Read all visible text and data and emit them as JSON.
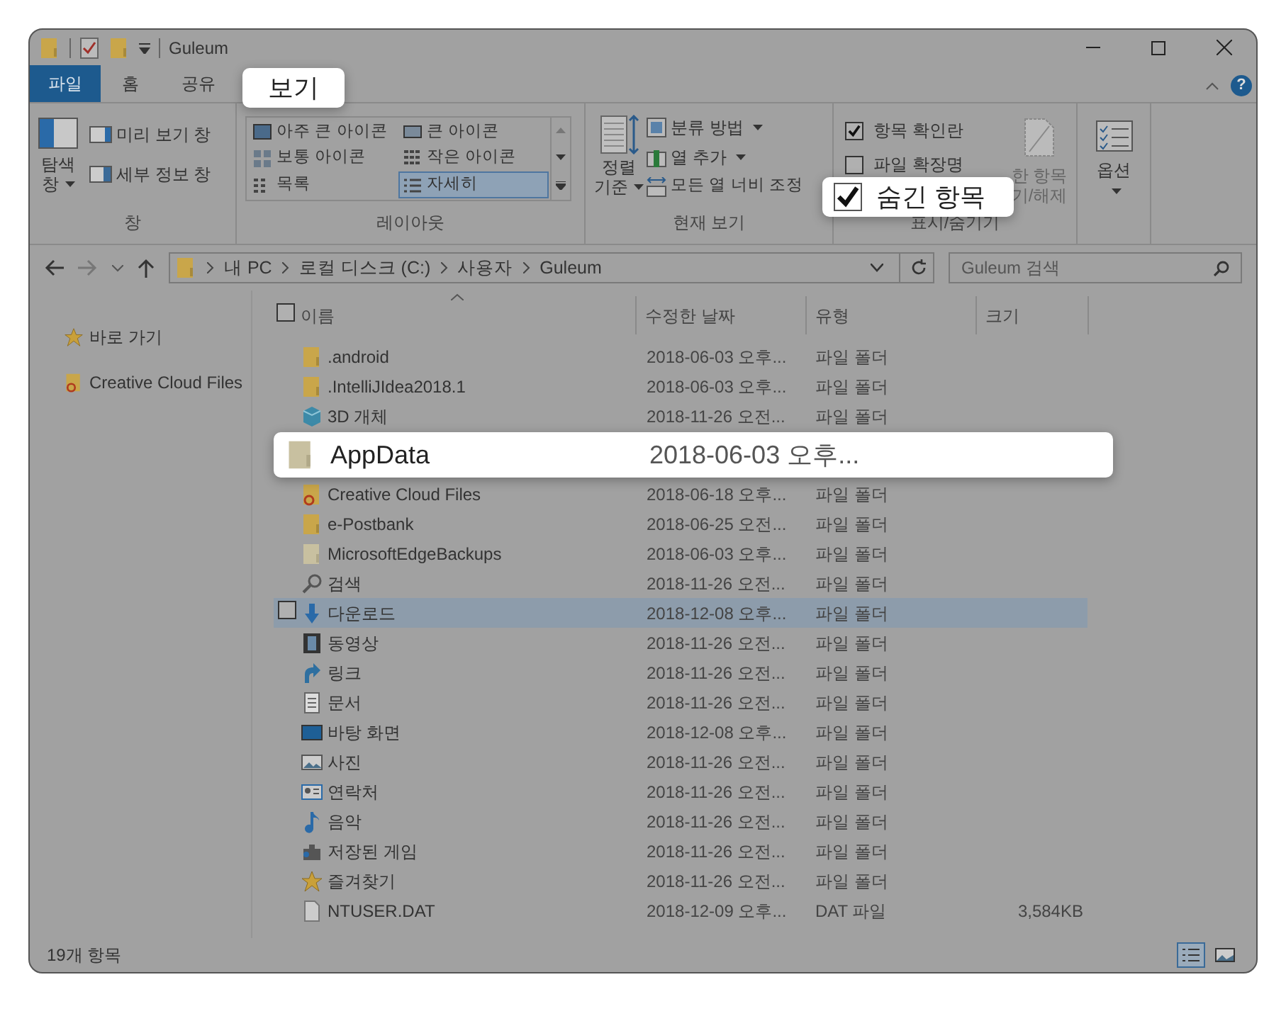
{
  "title_bar": {
    "title": "Guleum"
  },
  "ribbon_tabs": [
    {
      "label": "파일",
      "kind": "file",
      "selected": false
    },
    {
      "label": "홈",
      "kind": "tab",
      "selected": false
    },
    {
      "label": "공유",
      "kind": "tab",
      "selected": false
    },
    {
      "label": "보기",
      "kind": "tab",
      "selected": true
    }
  ],
  "pane_group": {
    "label": "창",
    "nav_pane": [
      "탐색",
      "창"
    ],
    "preview_pane": "미리 보기 창",
    "details_pane": "세부 정보 창"
  },
  "layout_group": {
    "label": "레이아웃",
    "options": [
      {
        "label": "아주 큰 아이콘",
        "kind": "xl",
        "selected": false
      },
      {
        "label": "큰 아이콘",
        "kind": "large",
        "selected": false
      },
      {
        "label": "보통 아이콘",
        "kind": "medium",
        "selected": false
      },
      {
        "label": "작은 아이콘",
        "kind": "small",
        "selected": false
      },
      {
        "label": "목록",
        "kind": "list",
        "selected": false
      },
      {
        "label": "자세히",
        "kind": "details",
        "selected": true
      }
    ]
  },
  "current_view_group": {
    "label": "현재 보기",
    "sort_by": [
      "정렬",
      "기준"
    ],
    "group_by": "분류 방법",
    "add_columns": "열 추가",
    "fit_columns": "모든 열 너비 조정"
  },
  "show_hide_group": {
    "label": "표시/숨기기",
    "checkboxes": [
      {
        "label": "항목 확인란",
        "checked": true,
        "highlighted": false
      },
      {
        "label": "파일 확장명",
        "checked": false,
        "highlighted": false
      },
      {
        "label": "숨긴 항목",
        "checked": true,
        "highlighted": true
      }
    ],
    "hide_selected": [
      "한 항목",
      "기/해제"
    ]
  },
  "options_group": {
    "label": "옵션"
  },
  "help_button": {
    "label": "?"
  },
  "header_checkbox": {
    "checked": false
  },
  "address_bar": {
    "path": [
      "내 PC",
      "로컬 디스크 (C:)",
      "사용자",
      "Guleum"
    ]
  },
  "search": {
    "placeholder": "Guleum 검색"
  },
  "nav_pane": [
    {
      "label": "바로 가기",
      "kind": "star"
    },
    {
      "label": "Creative Cloud Files",
      "kind": "cc"
    }
  ],
  "columns": [
    "이름",
    "수정한 날짜",
    "유형",
    "크기"
  ],
  "rows": [
    {
      "name": ".android",
      "date": "2018-06-03 오후...",
      "type": "파일 폴더",
      "kind": "folder",
      "selected": false,
      "highlighted": false
    },
    {
      "name": ".IntelliJIdea2018.1",
      "date": "2018-06-03 오후...",
      "type": "파일 폴더",
      "kind": "folder",
      "selected": false,
      "highlighted": false
    },
    {
      "name": "3D 개체",
      "date": "2018-11-26 오전...",
      "type": "파일 폴더",
      "kind": "cube",
      "selected": false,
      "highlighted": false
    },
    {
      "name": "AppData",
      "date": "2018-06-03 오후...",
      "kind": "hidden-folder",
      "selected": false,
      "highlighted": true
    },
    {
      "name": "Creative Cloud Files",
      "date": "2018-06-18 오후...",
      "type": "파일 폴더",
      "kind": "cc",
      "selected": false,
      "highlighted": false
    },
    {
      "name": "e-Postbank",
      "date": "2018-06-25 오전...",
      "type": "파일 폴더",
      "kind": "folder",
      "selected": false,
      "highlighted": false
    },
    {
      "name": "MicrosoftEdgeBackups",
      "date": "2018-06-03 오후...",
      "type": "파일 폴더",
      "kind": "hidden-folder",
      "selected": false,
      "highlighted": false
    },
    {
      "name": "검색",
      "date": "2018-11-26 오전...",
      "type": "파일 폴더",
      "kind": "search",
      "selected": false,
      "highlighted": false
    },
    {
      "name": "다운로드",
      "date": "2018-12-08 오후...",
      "type": "파일 폴더",
      "kind": "download",
      "selected": true,
      "highlighted": false
    },
    {
      "name": "동영상",
      "date": "2018-11-26 오전...",
      "type": "파일 폴더",
      "kind": "video",
      "selected": false,
      "highlighted": false
    },
    {
      "name": "링크",
      "date": "2018-11-26 오전...",
      "type": "파일 폴더",
      "kind": "link",
      "selected": false,
      "highlighted": false
    },
    {
      "name": "문서",
      "date": "2018-11-26 오전...",
      "type": "파일 폴더",
      "kind": "document",
      "selected": false,
      "highlighted": false
    },
    {
      "name": "바탕 화면",
      "date": "2018-12-08 오후...",
      "type": "파일 폴더",
      "kind": "desktop",
      "selected": false,
      "highlighted": false
    },
    {
      "name": "사진",
      "date": "2018-11-26 오전...",
      "type": "파일 폴더",
      "kind": "picture",
      "selected": false,
      "highlighted": false
    },
    {
      "name": "연락처",
      "date": "2018-11-26 오전...",
      "type": "파일 폴더",
      "kind": "contact",
      "selected": false,
      "highlighted": false
    },
    {
      "name": "음악",
      "date": "2018-11-26 오전...",
      "type": "파일 폴더",
      "kind": "music",
      "selected": false,
      "highlighted": false
    },
    {
      "name": "저장된 게임",
      "date": "2018-11-26 오전...",
      "type": "파일 폴더",
      "kind": "game",
      "selected": false,
      "highlighted": false
    },
    {
      "name": "즐겨찾기",
      "date": "2018-11-26 오전...",
      "type": "파일 폴더",
      "kind": "star",
      "selected": false,
      "highlighted": false
    },
    {
      "name": "NTUSER.DAT",
      "date": "2018-12-09 오후...",
      "type": "DAT 파일",
      "size": "3,584KB",
      "kind": "file",
      "selected": false,
      "highlighted": false
    }
  ],
  "status_bar": {
    "item_count": "19개 항목"
  },
  "view_buttons": [
    {
      "kind": "details",
      "selected": true
    },
    {
      "kind": "thumbnails",
      "selected": false
    }
  ]
}
